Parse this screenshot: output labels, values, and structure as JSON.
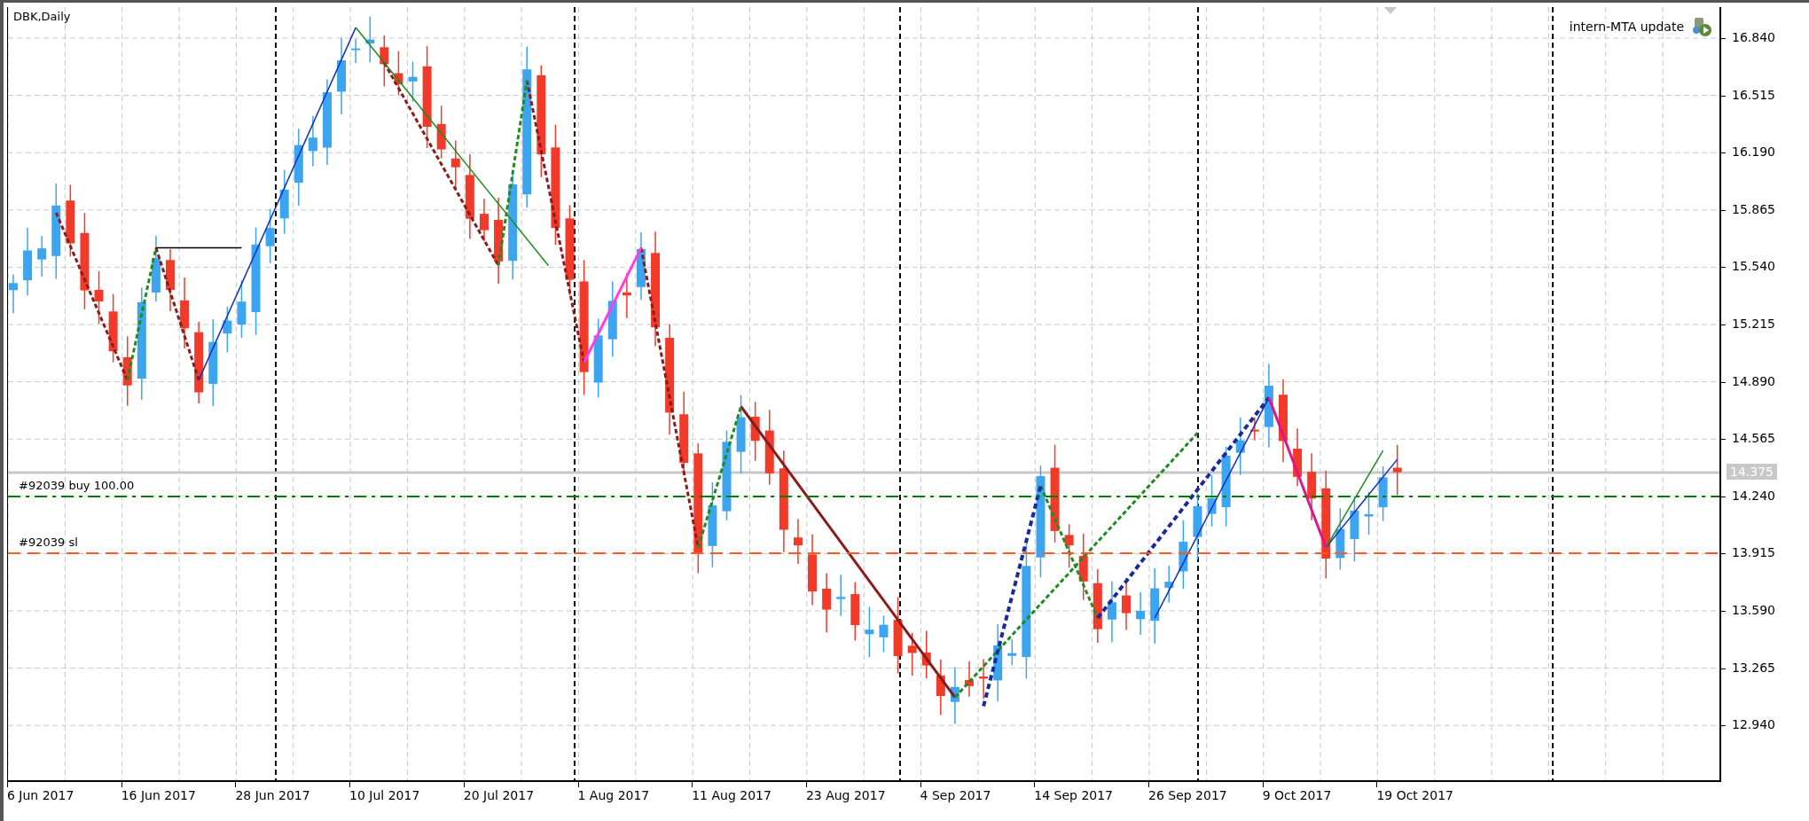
{
  "chart": {
    "title": "DBK,Daily",
    "expert": "intern-MTA update",
    "price_ticks": [
      "16.840",
      "16.515",
      "16.190",
      "15.865",
      "15.540",
      "15.215",
      "14.890",
      "14.565",
      "14.240",
      "13.915",
      "13.590",
      "13.265",
      "12.940"
    ],
    "current_price": "14.375",
    "date_labels": [
      "6 Jun 2017",
      "16 Jun 2017",
      "28 Jun 2017",
      "10 Jul 2017",
      "20 Jul 2017",
      "1 Aug 2017",
      "11 Aug 2017",
      "23 Aug 2017",
      "4 Sep 2017",
      "14 Sep 2017",
      "26 Sep 2017",
      "9 Oct 2017",
      "19 Oct 2017"
    ],
    "order_lines": [
      {
        "label": "#92039 buy 100.00",
        "kind": "order",
        "color": "#008000"
      },
      {
        "label": "#92039 sl",
        "kind": "stop",
        "color": "#ff5a1e"
      }
    ]
  }
}
